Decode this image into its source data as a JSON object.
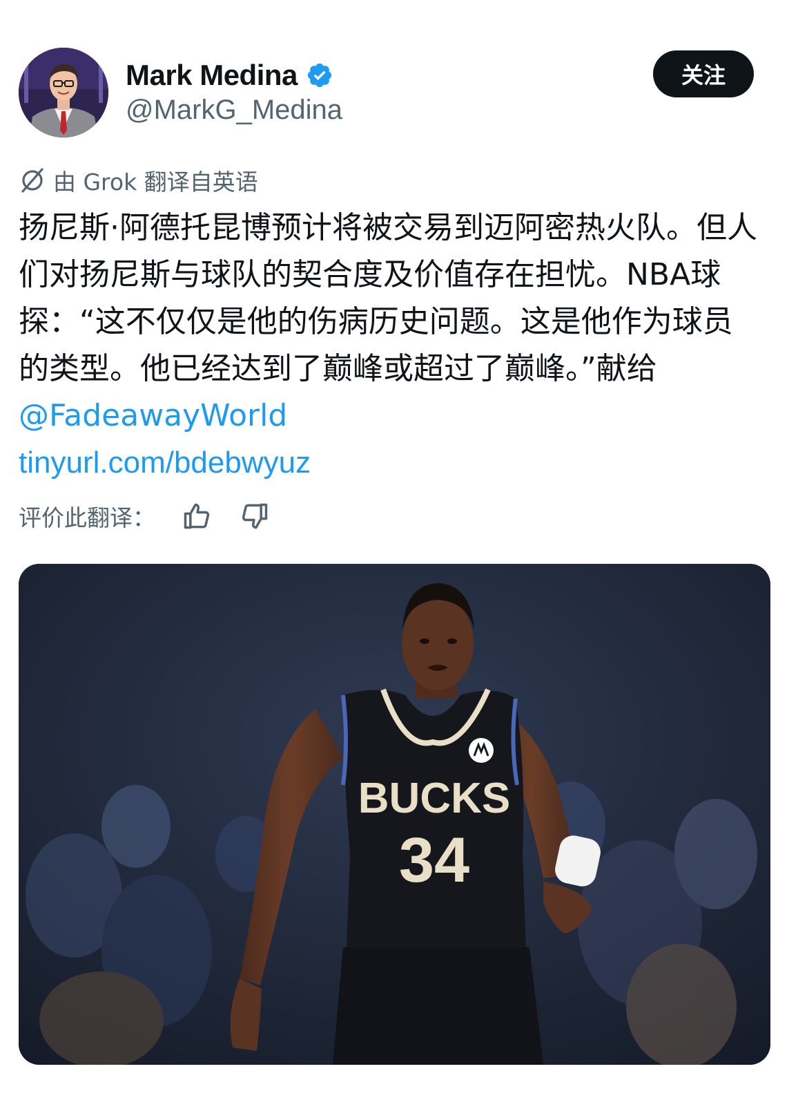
{
  "author": {
    "display_name": "Mark Medina",
    "handle": "@MarkG_Medina",
    "verified": true
  },
  "follow_button": {
    "label": "关注"
  },
  "translation_note": {
    "text": "由 Grok 翻译自英语",
    "icon": "grok-icon"
  },
  "tweet": {
    "text_main": "扬尼斯·阿德托昆博预计将被交易到迈阿密热火队。但人们对扬尼斯与球队的契合度及价值存在担忧。NBA球探：“这不仅仅是他的伤病历史问题。这是他作为球员的类型。他已经达到了巅峰或超过了巅峰。”献给 ",
    "mention": "@FadeawayWorld",
    "link": "tinyurl.com/bdebwyuz"
  },
  "rate_translation": {
    "label": "评价此翻译：",
    "up_icon": "thumbs-up-icon",
    "down_icon": "thumbs-down-icon"
  },
  "media": {
    "jersey_team": "BUCKS",
    "jersey_number": "34"
  },
  "colors": {
    "text": "#0f1419",
    "secondary": "#536471",
    "link": "#1d9bf0",
    "button_bg": "#0f1419",
    "verified": "#1d9bf0"
  }
}
